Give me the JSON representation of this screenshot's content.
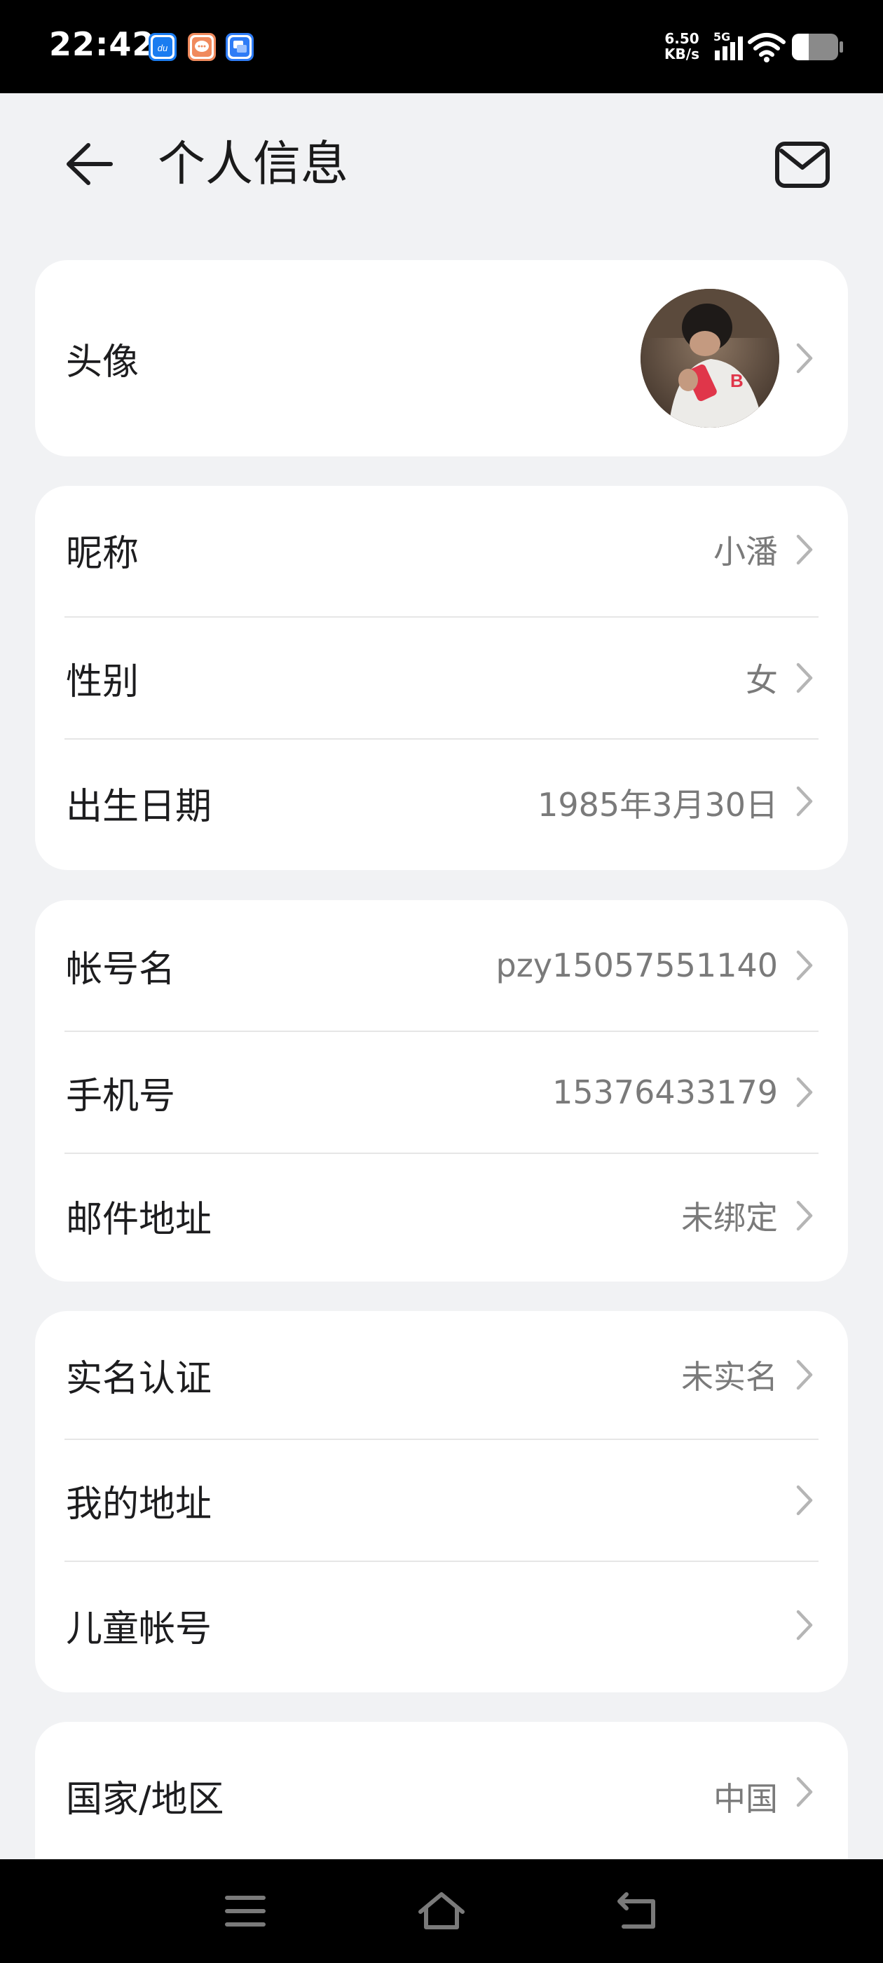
{
  "status_bar": {
    "time": "22:42",
    "net_speed_value": "6.50",
    "net_speed_unit": "KB/s",
    "network_type": "5G",
    "app_icons": [
      {
        "name": "du-app-icon",
        "label": "du",
        "color": "#1a7cf0"
      },
      {
        "name": "message-app-icon",
        "label": "",
        "color": "#f08a5d"
      },
      {
        "name": "chat-app-icon",
        "label": "",
        "color": "#2e7cf6"
      }
    ]
  },
  "header": {
    "title": "个人信息"
  },
  "avatar_card": {
    "label": "头像"
  },
  "profile_card": {
    "rows": [
      {
        "label": "昵称",
        "value": "小潘"
      },
      {
        "label": "性别",
        "value": "女"
      },
      {
        "label": "出生日期",
        "value": "1985年3月30日"
      }
    ]
  },
  "account_card": {
    "rows": [
      {
        "label": "帐号名",
        "value": "pzy15057551140"
      },
      {
        "label": "手机号",
        "value": "15376433179"
      },
      {
        "label": "邮件地址",
        "value": "未绑定"
      }
    ]
  },
  "identity_card": {
    "rows": [
      {
        "label": "实名认证",
        "value": "未实名"
      },
      {
        "label": "我的地址",
        "value": ""
      },
      {
        "label": "儿童帐号",
        "value": ""
      }
    ]
  },
  "region_card": {
    "rows": [
      {
        "label": "国家/地区",
        "value": "中国"
      }
    ]
  },
  "colors": {
    "background": "#f1f2f4",
    "card": "#ffffff",
    "secondary_text": "#7a7a7a",
    "chevron": "#b5b5b5"
  }
}
